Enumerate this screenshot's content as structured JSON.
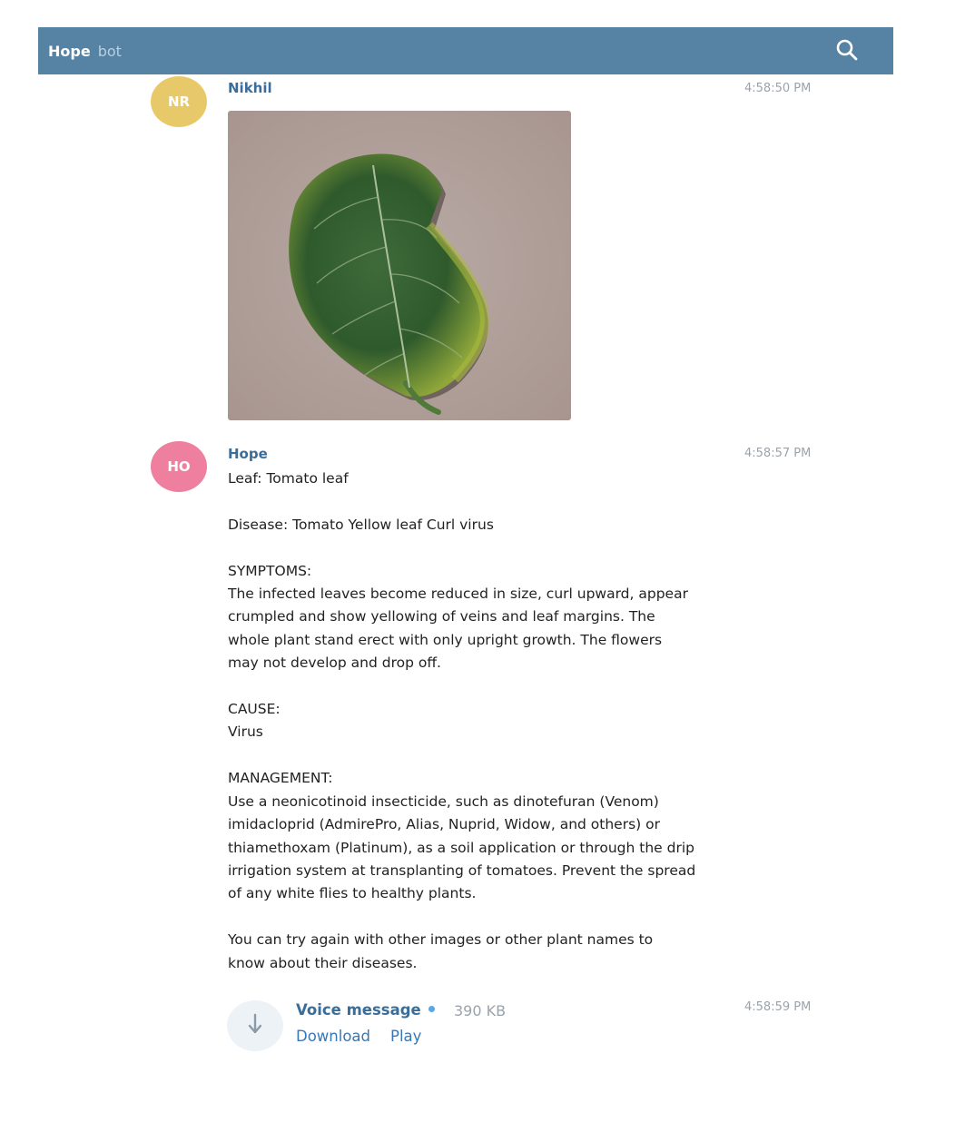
{
  "header": {
    "title": "Hope",
    "subtitle": "bot"
  },
  "messages": [
    {
      "avatar_initials": "NR",
      "avatar_color": "#e8c96a",
      "author": "Nikhil",
      "time": "4:58:50 PM"
    },
    {
      "avatar_initials": "HO",
      "avatar_color": "#ee7f9e",
      "author": "Hope",
      "time": "4:58:57 PM",
      "text": "Leaf: Tomato leaf\n\nDisease: Tomato Yellow leaf Curl virus\n\nSYMPTOMS:\nThe infected leaves become reduced in size, curl upward, appear\ncrumpled and show yellowing of veins and leaf margins. The\nwhole plant stand erect with only upright growth. The flowers\nmay not develop and drop off.\n\nCAUSE:\nVirus\n\nMANAGEMENT:\nUse a neonicotinoid insecticide, such as dinotefuran (Venom)\nimidacloprid (AdmirePro, Alias, Nuprid, Widow, and others) or\nthiamethoxam (Platinum), as a soil application or through the drip\nirrigation system at transplanting of tomatoes. Prevent the spread\nof any white flies to healthy plants.\n\nYou can try again with other images or other plant names to\nknow about their diseases."
    }
  ],
  "voice": {
    "title": "Voice message",
    "size": "390 KB",
    "download_label": "Download",
    "play_label": "Play",
    "time": "4:58:59 PM"
  },
  "colors": {
    "header_bg": "#5682a3",
    "author": "#3a6d99",
    "link": "#3a77b5"
  }
}
